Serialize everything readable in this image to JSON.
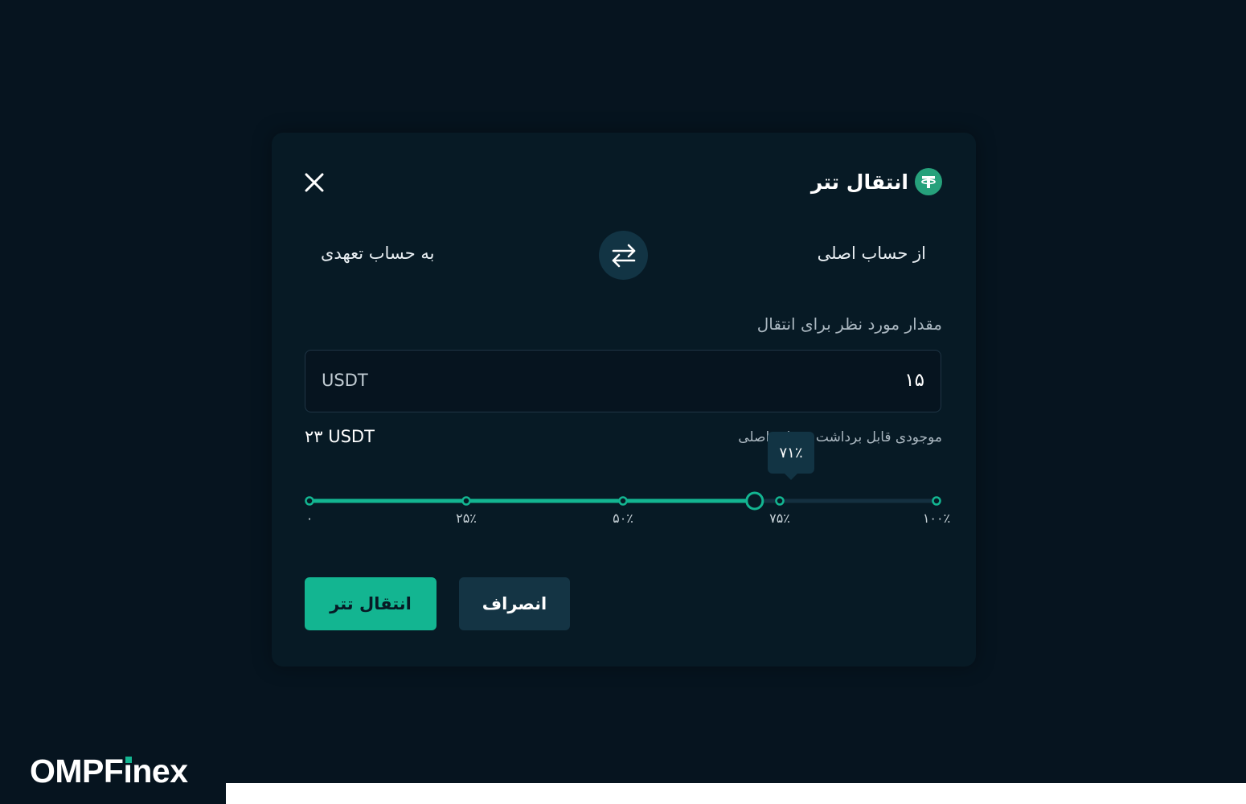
{
  "dialog": {
    "title": "انتقال تتر",
    "title_icon": "tether-icon",
    "close_icon": "close-icon"
  },
  "transfer": {
    "from_label": "از حساب اصلی",
    "to_label": "به حساب تعهدی",
    "swap_icon": "swap-arrows-icon"
  },
  "amount": {
    "label": "مقدار مورد نظر برای انتقال",
    "value": "۱۵",
    "unit": "USDT"
  },
  "balance": {
    "label": "موجودی قابل برداشت حساب اصلی",
    "value": "۲۳ USDT"
  },
  "slider": {
    "percent": 71,
    "tooltip": "۷۱٪",
    "ticks": [
      "۰",
      "۲۵٪",
      "۵۰٪",
      "۷۵٪",
      "۱۰۰٪"
    ],
    "tick_values": [
      0,
      25,
      50,
      75,
      100
    ]
  },
  "actions": {
    "submit_label": "انتقال تتر",
    "cancel_label": "انصراف"
  },
  "brand": {
    "name_prefix": "OMPF",
    "name_i": "i",
    "name_suffix": "nex"
  },
  "colors": {
    "accent": "#13b591",
    "background": "#06141f",
    "panel": "#071a25",
    "track": "#143040"
  }
}
